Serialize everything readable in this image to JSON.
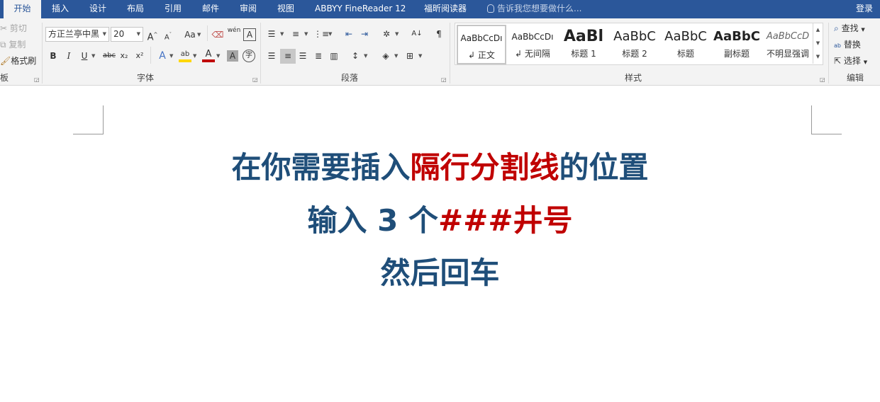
{
  "tabs": [
    {
      "label": "开始",
      "active": true
    },
    {
      "label": "插入"
    },
    {
      "label": "设计"
    },
    {
      "label": "布局"
    },
    {
      "label": "引用"
    },
    {
      "label": "邮件"
    },
    {
      "label": "审阅"
    },
    {
      "label": "视图"
    },
    {
      "label": "ABBYY FineReader 12"
    },
    {
      "label": "福昕阅读器"
    }
  ],
  "tell_me": "告诉我您想要做什么...",
  "login": "登录",
  "clipboard": {
    "cut": "剪切",
    "copy": "复制",
    "format_painter": "格式刷",
    "label": "板"
  },
  "font": {
    "name": "方正兰亭中黑",
    "size": "20",
    "label": "字体",
    "bold": "B",
    "italic": "I",
    "underline": "U",
    "strike": "abc",
    "sub": "x₂",
    "sup": "x²",
    "grow": "A",
    "shrink": "A",
    "case": "Aa",
    "phonetic": "wén",
    "color_a": "A",
    "char_border": "A",
    "enclose": "字",
    "font_color": "#c00000",
    "highlight_color": "#ffd700"
  },
  "paragraph": {
    "label": "段落"
  },
  "styles": {
    "label": "样式",
    "items": [
      {
        "preview": "AaBbCcDı",
        "name": "正文",
        "selected": true
      },
      {
        "preview": "AaBbCcDı",
        "name": "无间隔"
      },
      {
        "preview": "AaBl",
        "name": "标题 1"
      },
      {
        "preview": "AaBbC",
        "name": "标题 2"
      },
      {
        "preview": "AaBbC",
        "name": "标题"
      },
      {
        "preview": "AaBbC",
        "name": "副标题"
      },
      {
        "preview": "AaBbCcD",
        "name": "不明显强调"
      }
    ]
  },
  "editing": {
    "find": "查找",
    "replace": "替换",
    "select": "选择",
    "label": "编辑"
  },
  "document": {
    "line1_a": "在你需要插入",
    "line1_b": "隔行分割线",
    "line1_c": "的位置",
    "line2_a": "输入 3 个",
    "line2_b": "###井号",
    "line3": "然后回车",
    "blue": "#1f4e79",
    "red": "#c00000"
  }
}
